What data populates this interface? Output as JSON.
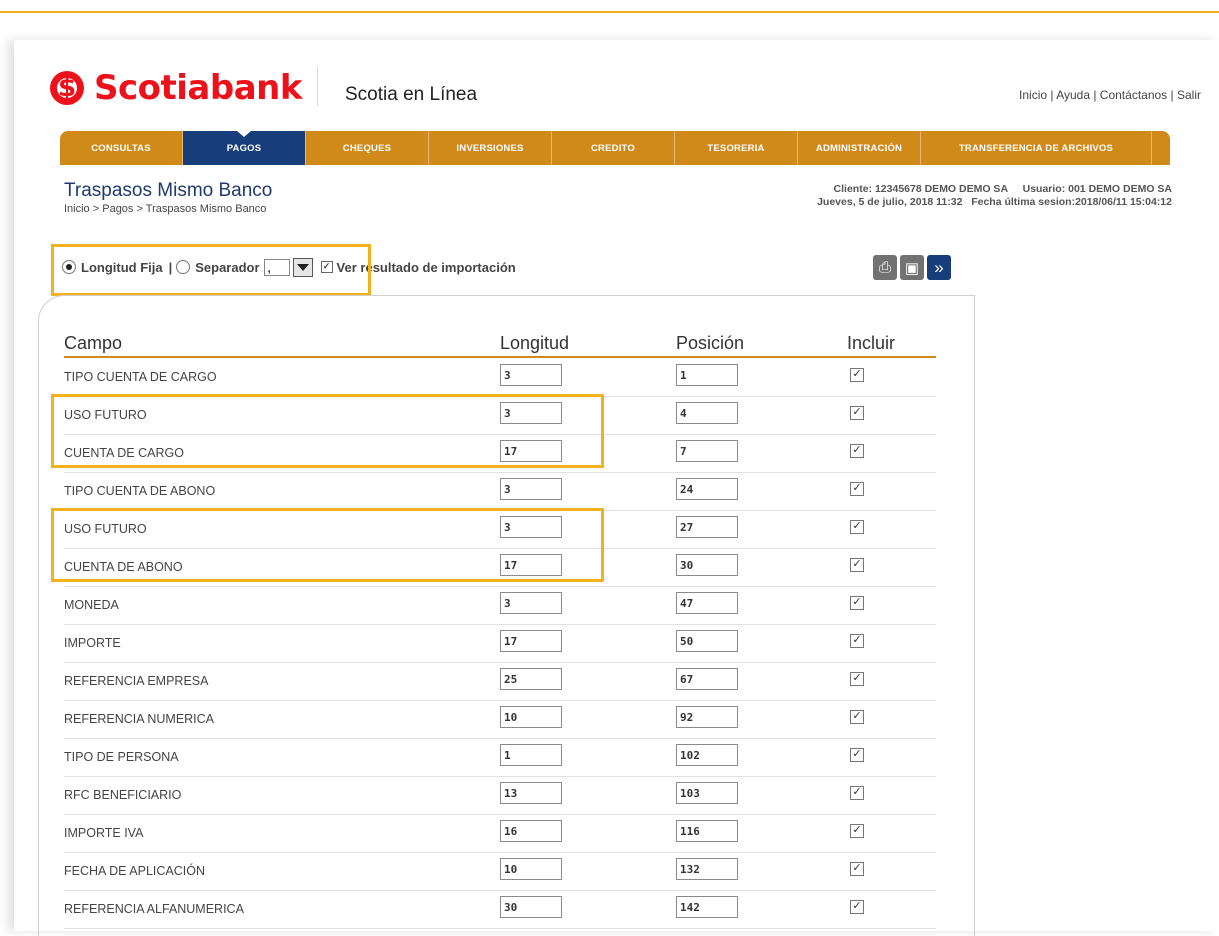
{
  "brand": {
    "name": "Scotiabank",
    "product": "Scotia en Línea",
    "color": "#ec111a"
  },
  "top_links": [
    "Inicio",
    "Ayuda",
    "Contáctanos",
    "Salir"
  ],
  "nav": [
    "CONSULTAS",
    "PAGOS",
    "CHEQUES",
    "INVERSIONES",
    "CREDITO",
    "TESORERIA",
    "ADMINISTRACIÓN",
    "TRANSFERENCIA DE ARCHIVOS"
  ],
  "nav_active": "PAGOS",
  "page": {
    "title": "Traspasos Mismo Banco",
    "breadcrumb": [
      "Inicio",
      "Pagos",
      "Traspasos Mismo Banco"
    ],
    "client": "Cliente: 12345678 DEMO DEMO SA",
    "user": "Usuario: 001 DEMO DEMO SA",
    "date": "Jueves, 5 de julio, 2018 11:32",
    "last_session": "Fecha última sesion:2018/06/11 15:04:12"
  },
  "options": {
    "fixed_label": "Longitud Fija",
    "separator_label": "Separador",
    "separator_value": ",",
    "show_result_label": "Ver resultado de importación",
    "mode": "Longitud Fija",
    "show_result": true
  },
  "table": {
    "headers": [
      "Campo",
      "Longitud",
      "Posición",
      "Incluir"
    ],
    "rows": [
      {
        "campo": "TIPO CUENTA DE CARGO",
        "longitud": "3",
        "posicion": "1",
        "incluir": true
      },
      {
        "campo": "USO FUTURO",
        "longitud": "3",
        "posicion": "4",
        "incluir": true
      },
      {
        "campo": "CUENTA DE CARGO",
        "longitud": "17",
        "posicion": "7",
        "incluir": true
      },
      {
        "campo": "TIPO CUENTA DE ABONO",
        "longitud": "3",
        "posicion": "24",
        "incluir": true
      },
      {
        "campo": "USO FUTURO",
        "longitud": "3",
        "posicion": "27",
        "incluir": true
      },
      {
        "campo": "CUENTA DE ABONO",
        "longitud": "17",
        "posicion": "30",
        "incluir": true
      },
      {
        "campo": "MONEDA",
        "longitud": "3",
        "posicion": "47",
        "incluir": true
      },
      {
        "campo": "IMPORTE",
        "longitud": "17",
        "posicion": "50",
        "incluir": true
      },
      {
        "campo": "REFERENCIA EMPRESA",
        "longitud": "25",
        "posicion": "67",
        "incluir": true
      },
      {
        "campo": "REFERENCIA NUMERICA",
        "longitud": "10",
        "posicion": "92",
        "incluir": true
      },
      {
        "campo": "TIPO DE PERSONA",
        "longitud": "1",
        "posicion": "102",
        "incluir": true
      },
      {
        "campo": "RFC BENEFICIARIO",
        "longitud": "13",
        "posicion": "103",
        "incluir": true
      },
      {
        "campo": "IMPORTE IVA",
        "longitud": "16",
        "posicion": "116",
        "incluir": true
      },
      {
        "campo": "FECHA DE APLICACIÓN",
        "longitud": "10",
        "posicion": "132",
        "incluir": true
      },
      {
        "campo": "REFERENCIA ALFANUMERICA",
        "longitud": "30",
        "posicion": "142",
        "incluir": true
      }
    ]
  },
  "toolbar_icons": [
    "print-icon",
    "save-icon",
    "next-icon"
  ],
  "highlight_color": "#f2b21b"
}
